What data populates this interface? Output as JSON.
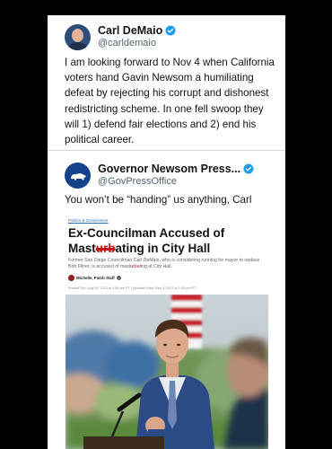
{
  "tweet1": {
    "name": "Carl DeMaio",
    "handle": "@carldemaio",
    "text": "I am looking forward to Nov 4 when California voters hand Gavin Newsom a humiliating defeat by rejecting his corrupt and dishonest redistricting scheme.  In one fell swoop they will 1) defend fair elections and 2) end his political career."
  },
  "tweet2": {
    "name": "Governor Newsom Press...",
    "handle": "@GovPressOffice",
    "text": "You won’t be “handing” us anything, Carl"
  },
  "article": {
    "category": "Politics & Government",
    "headline_pre": "Ex-Councilman Accused of Mast",
    "headline_censor": "urb",
    "headline_post": "ating in City Hall",
    "dek_pre": "Former San Diego Councilman Carl DeMaio, who is considering running for mayor to replace Bob Filner, is accused of mast",
    "dek_censor": "urb",
    "dek_post": "ating at City Hall.",
    "author": "Michelle, Patch Staff",
    "posted": "Posted Thu, Aug 29, 2013 at 1:56 am PT  |  Updated Wed, Sep 4, 2013 at 1:26 pm PT"
  },
  "colors": {
    "verified": "#1d9bf0",
    "link": "#2a6ebb",
    "censor": "#c01818"
  }
}
